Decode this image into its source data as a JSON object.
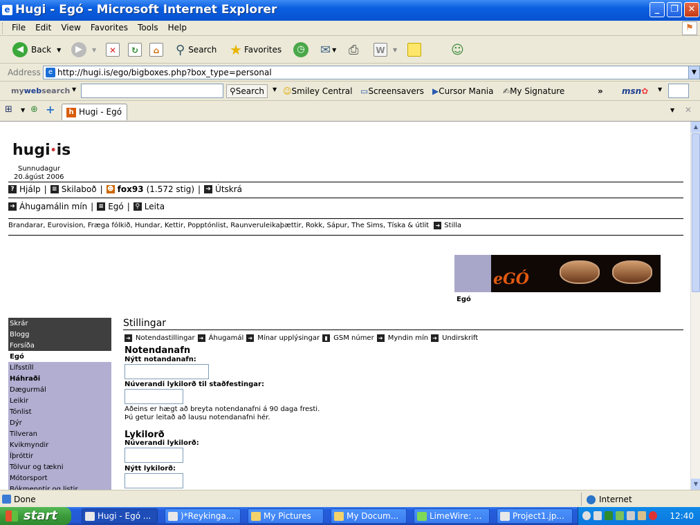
{
  "window": {
    "title": "Hugi - Egó - Microsoft Internet Explorer"
  },
  "menu": [
    "File",
    "Edit",
    "View",
    "Favorites",
    "Tools",
    "Help"
  ],
  "toolbar": {
    "back": "Back",
    "search": "Search",
    "favorites": "Favorites"
  },
  "address": {
    "label": "Address",
    "url": "http://hugi.is/ego/bigboxes.php?box_type=personal"
  },
  "msnbar": {
    "brand_my": "my",
    "brand_web": "web",
    "brand_search": "search",
    "search": "Search",
    "smiley": "Smiley Central",
    "screensavers": "Screensavers",
    "cursor": "Cursor Mania",
    "signature": "My Signature",
    "more": "»",
    "msn": "msn"
  },
  "tab": {
    "label": "Hugi - Egó"
  },
  "site": {
    "logo_left": "hugi",
    "logo_right": "is",
    "day": "Sunnudagur",
    "date": "20.ágúst 2006",
    "help": "Hjálp",
    "messages": "Skilaboð",
    "username": "fox93",
    "points": "(1.572 stig)",
    "logout": "Útskrá",
    "my_interests": "Áhugamálin mín",
    "ego": "Egó",
    "search": "Leita",
    "interests": "Brandarar, Eurovision, Fræga fólkið, Hundar, Kettir, Popptónlist, Raunveruleikaþættir, Rokk, Sápur, The Sims, Tíska & útlit",
    "settings_link": "Stilla",
    "banner_text": "eGÓ",
    "banner_caption": "Egó"
  },
  "sidebar": [
    {
      "label": "Skrár",
      "style": "dark"
    },
    {
      "label": "Blogg",
      "style": "dark"
    },
    {
      "label": "Forsíða",
      "style": "dark"
    },
    {
      "label": "Egó",
      "style": "white"
    },
    {
      "label": "Lífsstíll",
      "style": "lav"
    },
    {
      "label": "Háhraði",
      "style": "lav b"
    },
    {
      "label": "Dægurmál",
      "style": "lav"
    },
    {
      "label": "Leikir",
      "style": "lav"
    },
    {
      "label": "Tónlist",
      "style": "lav"
    },
    {
      "label": "Dýr",
      "style": "lav"
    },
    {
      "label": "Tilveran",
      "style": "lav"
    },
    {
      "label": "Kvikmyndir",
      "style": "lav"
    },
    {
      "label": "Íþróttir",
      "style": "lav"
    },
    {
      "label": "Tölvur og tækni",
      "style": "lav"
    },
    {
      "label": "Mótorsport",
      "style": "lav"
    },
    {
      "label": "Bókmenntir og listir",
      "style": "lav"
    }
  ],
  "settings": {
    "title": "Stillingar",
    "nav": [
      "Notendastillingar",
      "Áhugamál",
      "Mínar upplýsingar",
      "GSM númer",
      "Myndin mín",
      "Undirskrift"
    ],
    "username_section": "Notendanafn",
    "new_username_label": "Nýtt notandanafn:",
    "current_pw_confirm_label": "Núverandi lykilorð til staðfestingar:",
    "note_line1": "Aðeins er hægt að breyta notendanafni á 90 daga fresti.",
    "note_line2": "Þú getur leitað að lausu notendanafni hér.",
    "password_section": "Lykilorð",
    "current_pw_label": "Núverandi lykilorð:",
    "new_pw_label": "Nýtt lykilorð:"
  },
  "status": {
    "text": "Done",
    "zone": "Internet"
  },
  "taskbar": {
    "start": "start",
    "tasks": [
      "Hugi - Egó ...",
      ")*Reykinga...",
      "My Pictures",
      "My Docum...",
      "LimeWire: ...",
      "Project1.jp..."
    ],
    "clock": "12:40"
  }
}
